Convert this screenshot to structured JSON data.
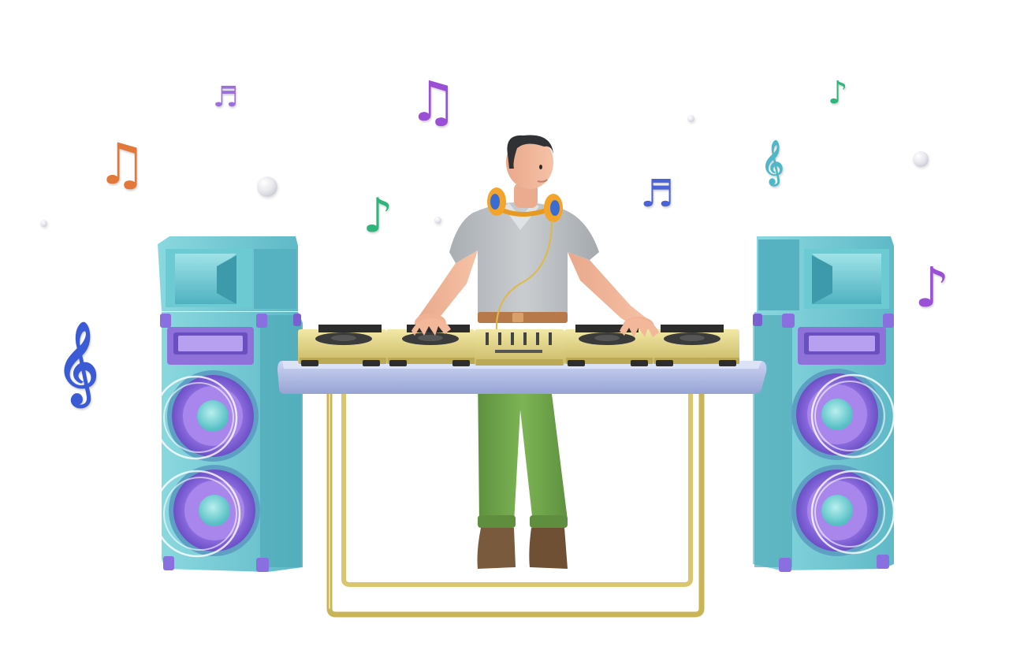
{
  "scene": {
    "subject": "dj-at-turntables",
    "colors": {
      "background": "#ffffff",
      "speaker_body": "#7ccfd6",
      "speaker_horn": "#5fc3cf",
      "speaker_cone": "#9b7be0",
      "speaker_dust_cap": "#7fd6d6",
      "speaker_accent": "#8a6fe0",
      "table_top": "#b7c3e8",
      "table_legs": "#d8c46a",
      "deck": "#e6d98a",
      "platter": "#3b3b3b",
      "shirt": "#b9bec2",
      "pants": "#6fa04a",
      "belt": "#b8794a",
      "skin": "#f3b79a",
      "hair": "#2f3134",
      "headphones": "#f2a52a",
      "shoes": "#7a5a3c"
    },
    "notes": [
      {
        "name": "beamed-triplet-note-icon",
        "color": "#9b6fe0"
      },
      {
        "name": "beamed-pair-note-icon",
        "color": "#9b4fd6"
      },
      {
        "name": "beamed-pair-note-icon",
        "color": "#e2793a"
      },
      {
        "name": "eighth-note-icon",
        "color": "#2fb47c"
      },
      {
        "name": "beamed-quad-note-icon",
        "color": "#4a63d6"
      },
      {
        "name": "treble-clef-icon",
        "color": "#4fb8c8"
      },
      {
        "name": "eighth-note-icon",
        "color": "#2fb47c"
      },
      {
        "name": "eighth-note-icon",
        "color": "#9b4fd6"
      },
      {
        "name": "treble-clef-icon",
        "color": "#3b5bd6"
      }
    ]
  }
}
